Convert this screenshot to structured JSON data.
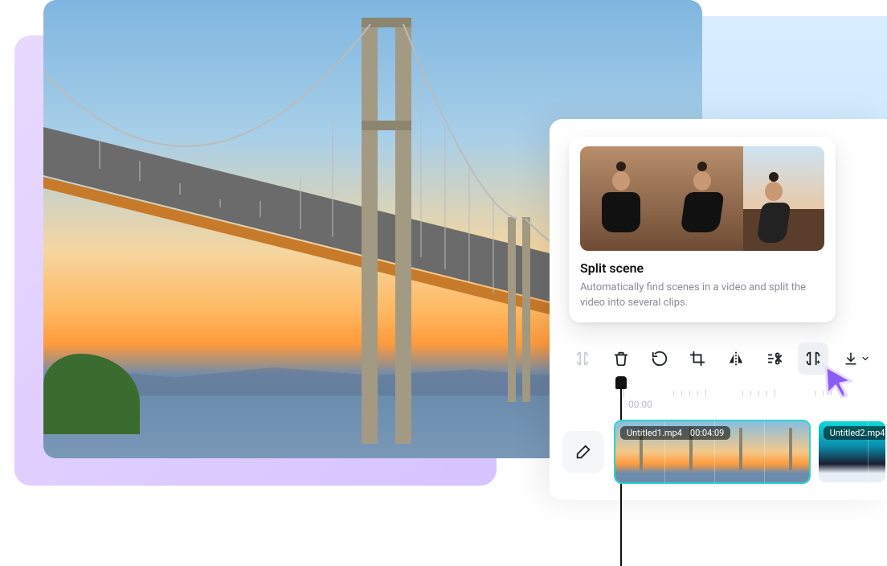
{
  "card": {
    "title": "Split scene",
    "description": "Automatically find scenes in a video and split the video into several clips."
  },
  "toolbar": {
    "split_icon": "split-icon",
    "delete_icon": "trash-icon",
    "rotate_icon": "rotate-icon",
    "crop_icon": "crop-icon",
    "flip_icon": "flip-icon",
    "cut_icon": "scissors-icon",
    "smart_split_icon": "smart-split-icon",
    "download_icon": "download-icon"
  },
  "timeline": {
    "start_time": "00:00",
    "playhead_time": "00:00"
  },
  "clips": [
    {
      "filename": "Untitled1.mp4",
      "duration": "00:04:09"
    },
    {
      "filename": "Untitled2.mp4",
      "duration": ""
    }
  ],
  "colors": {
    "accent": "#8b5cf6",
    "teal_border": "#2dd4cf"
  }
}
